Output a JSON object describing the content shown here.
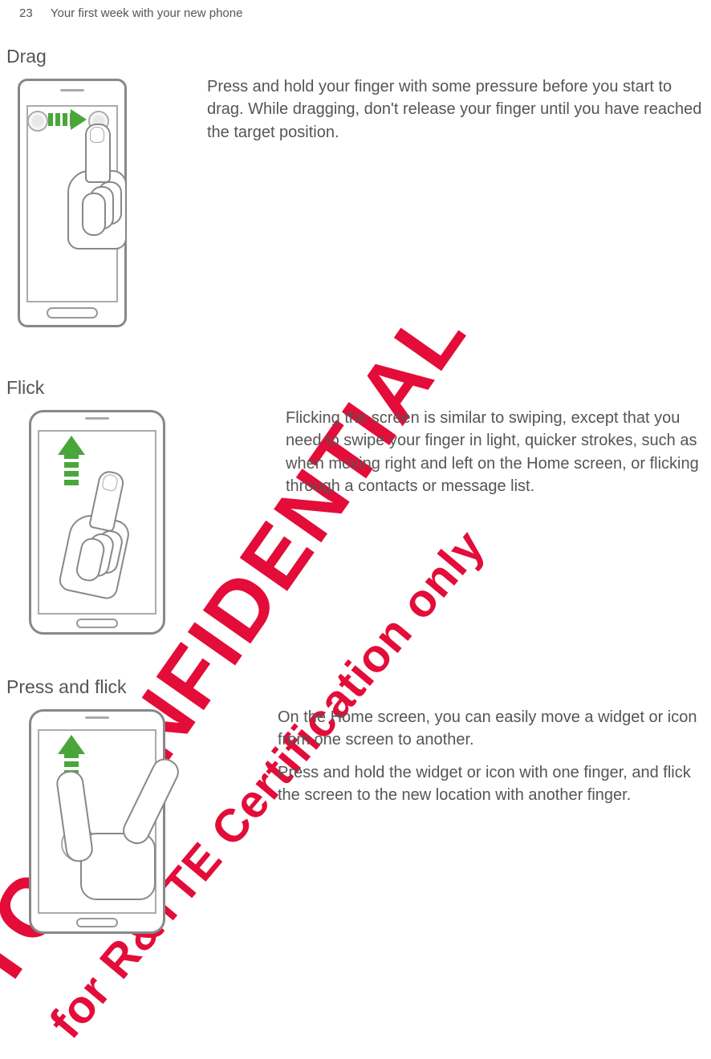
{
  "header": {
    "page_number": "23",
    "chapter": "Your first week with your new phone"
  },
  "watermarks": {
    "w1": "HTC CONFIDENTIAL",
    "w2": "for R&TTE Certification only"
  },
  "sections": {
    "drag": {
      "title": "Drag",
      "body": "Press and hold your finger with some pressure before you start to drag. While dragging, don't release your finger until you have reached the target position."
    },
    "flick": {
      "title": "Flick",
      "body": "Flicking the screen is similar to swiping, except that you need to swipe your finger in light, quicker strokes, such as when moving right and left on the Home screen, or flicking through a contacts or message list."
    },
    "pressflick": {
      "title": "Press and flick",
      "body1": "On the Home screen, you can easily move a widget or icon from one screen to another.",
      "body2": "Press and hold the widget or icon with one finger, and flick the screen to the new location with another finger."
    }
  }
}
